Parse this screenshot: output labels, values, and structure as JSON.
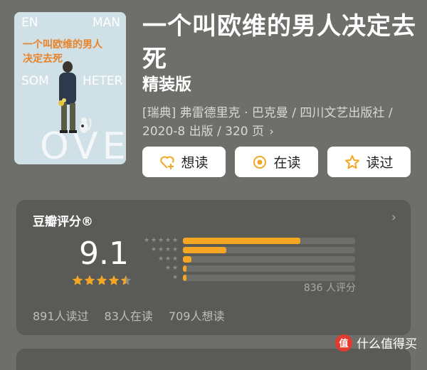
{
  "book": {
    "title": "一个叫欧维的男人决定去死",
    "subtitle": "精装版",
    "meta": "[瑞典] 弗雷德里克 · 巴克曼 / 四川文艺出版社 / 2020-8 出版 / 320 页",
    "meta_chevron": "›",
    "cover": {
      "title_line1": "一个叫欧维的男人",
      "title_line2": "决定去死",
      "text_en_top_left": "EN",
      "text_en_top_right": "MAN",
      "text_en_mid_left": "SOM",
      "text_en_mid_right": "HETER",
      "text_en_bottom": "OVE",
      "bg_color": "#cfe0e6",
      "title_color": "#e8832a"
    }
  },
  "actions": [
    {
      "label": "想读",
      "icon": "heart-plus-icon",
      "color": "#f5a623"
    },
    {
      "label": "在读",
      "icon": "target-circle-icon",
      "color": "#f5a623"
    },
    {
      "label": "读过",
      "icon": "star-outline-icon",
      "color": "#f5a623"
    }
  ],
  "rating": {
    "header": "豆瓣评分®",
    "chevron": "›",
    "score": "9.1",
    "stars_value": 4.5,
    "count_label": "836 人评分",
    "distribution": [
      {
        "stars": 5,
        "fraction": 0.68
      },
      {
        "stars": 4,
        "fraction": 0.25
      },
      {
        "stars": 3,
        "fraction": 0.05
      },
      {
        "stars": 2,
        "fraction": 0.02
      },
      {
        "stars": 1,
        "fraction": 0.02
      }
    ],
    "stats": [
      "891人读过",
      "83人在读",
      "709人想读"
    ],
    "accent": "#f5a623"
  },
  "watermark": {
    "logo": "值",
    "text": "什么值得买"
  }
}
